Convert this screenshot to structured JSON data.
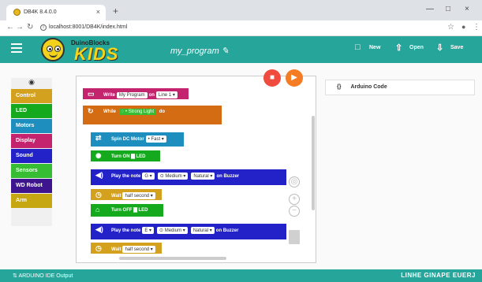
{
  "browser": {
    "tab_title": "DB4K 8.4.0.0",
    "url": "localhost:8001/DB4K/index.html"
  },
  "app": {
    "logo_top": "DuinoBlocks",
    "logo_kids": "KIDS",
    "program_name": "my_program ✎",
    "actions": [
      "New",
      "Open",
      "Save"
    ]
  },
  "categories": [
    {
      "label": "Control",
      "color": "#d3a11e"
    },
    {
      "label": "LED",
      "color": "#15a91e"
    },
    {
      "label": "Motors",
      "color": "#1e8ebe"
    },
    {
      "label": "Display",
      "color": "#c4246e"
    },
    {
      "label": "Sound",
      "color": "#2322c8"
    },
    {
      "label": "Sensors",
      "color": "#36bd33"
    },
    {
      "label": "WD Robot",
      "color": "#3f158f"
    },
    {
      "label": "Arm",
      "color": "#c6a611"
    }
  ],
  "blocks": {
    "write": {
      "text": "Write",
      "value": "My Program",
      "on": "on",
      "line": "Line 1 ▾"
    },
    "while": {
      "text": "While",
      "strong": "• Strong",
      "light": "Light",
      "do": "do"
    },
    "motor": {
      "text": "Spin DC Motor",
      "speed": "• Fast ▾"
    },
    "turn_on": "Turn ON ▇ LED",
    "note1": {
      "text": "Play the note",
      "note": "G ▾",
      "duration": "⊙ Medium ▾",
      "tone": "Natural ▾",
      "on": "on Buzzer"
    },
    "wait1": {
      "text": "Wait",
      "value": "half second ▾"
    },
    "turn_off": "Turn OFF ▇ LED",
    "note2": {
      "text": "Play the note",
      "note": "E ▾",
      "duration": "⊙ Medium ▾",
      "tone": "Natural ▾",
      "on": "on Buzzer"
    },
    "wait2": {
      "text": "Wait",
      "value": "half second ▾"
    }
  },
  "code_panel": {
    "braces": "{}",
    "label": "Arduino Code"
  },
  "bottom": {
    "output_label": "ARDUINO IDE Output",
    "brand": "LINHE GINAPE EUERJ"
  }
}
